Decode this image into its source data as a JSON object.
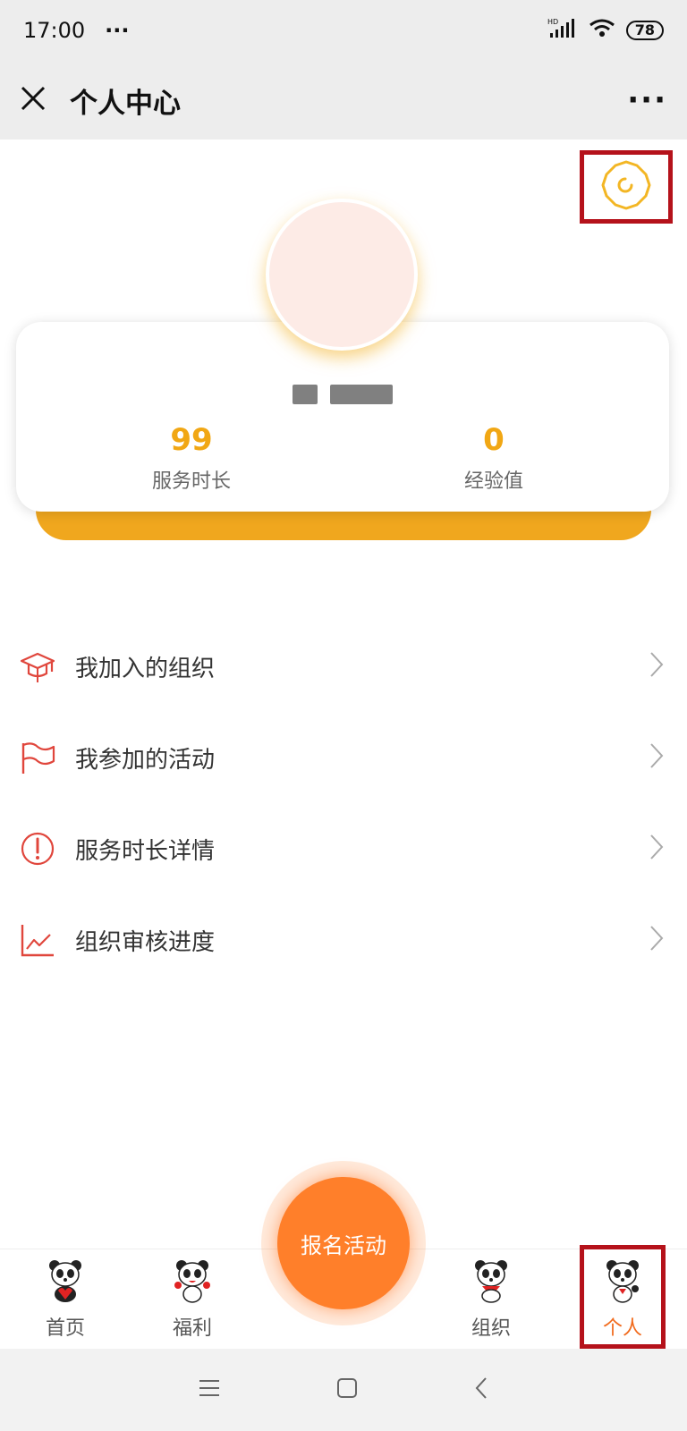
{
  "status_bar": {
    "time": "17:00",
    "dots": "···",
    "network": "HD",
    "battery": "78"
  },
  "title_bar": {
    "title": "个人中心",
    "more": "···"
  },
  "profile": {
    "stats": [
      {
        "value": "99",
        "label": "服务时长"
      },
      {
        "value": "0",
        "label": "经验值"
      }
    ]
  },
  "menu": {
    "items": [
      {
        "label": "我加入的组织",
        "icon": "graduation-cap-icon"
      },
      {
        "label": "我参加的活动",
        "icon": "flag-icon"
      },
      {
        "label": "服务时长详情",
        "icon": "exclamation-circle-icon"
      },
      {
        "label": "组织审核进度",
        "icon": "line-chart-icon"
      }
    ]
  },
  "fab": {
    "label": "报名活动"
  },
  "bottom_nav": {
    "items": [
      {
        "label": "首页"
      },
      {
        "label": "福利"
      },
      {
        "label": "组织"
      },
      {
        "label": "个人"
      }
    ],
    "active": "个人"
  },
  "colors": {
    "accent": "#f1a714",
    "brand_orange": "#ff7f2a",
    "menu_icon": "#e0463c",
    "highlight_box": "#b5121b"
  }
}
